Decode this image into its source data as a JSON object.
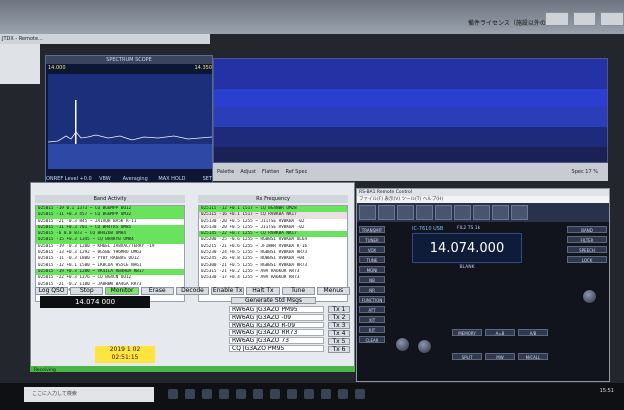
{
  "title_bar": {
    "left_window_title": "JTDX  - Remote...",
    "explorer_label": "備件ライセンス（施設以外の異物記）"
  },
  "spectrum": {
    "title": "SPECTRUM SCOPE",
    "left_freq": "14.000",
    "right_freq": "14.350",
    "buttons": [
      "ON",
      "REF Level +0.0 dB",
      "VBW NAR",
      "Averaging OFF",
      "MAX HOLD CLEAR",
      "SET"
    ]
  },
  "waterfall": {
    "controls": [
      "Palette",
      "Adjust",
      "Flatten",
      "Ref Spec"
    ],
    "zoom": "Spec 17 %"
  },
  "activity": {
    "band_activity_label": "Band Activity",
    "rx_frequency_label": "Rx Frequency",
    "left_rows": [
      {
        "text": "025015 -19  0.1 1373 ~ CQ BG6MPP OO12",
        "type": "cq"
      },
      {
        "text": "025015 -11 +0.3  457 ~ CQ BG6MPP OM32",
        "type": "cq"
      },
      {
        "text": "025015 -21 -0.3  845 ~ JA1VQH BA5K R-11",
        "type": "normal"
      },
      {
        "text": "025015 -11 +0.3  701 ~ CQ BH4TRS OM85",
        "type": "cq"
      },
      {
        "text": "025015  -6  0.0  873 ~ CQ BH4ZOB OM84",
        "type": "cq"
      },
      {
        "text": "025015 -15 +0.3 1345 ~ CQ BH4KYB OM84",
        "type": "cq"
      },
      {
        "text": "025015 -19 -0.3 1200 ~ KH6EL JA8VAC/TERRY -19",
        "type": "normal"
      },
      {
        "text": "025015 -13 +0.3 1292 ~ BG5BE YH6MRO OM63",
        "type": "normal"
      },
      {
        "text": "025015 -11 -0.3 1800 ~ YY0Y RA6BAS OO12",
        "type": "normal"
      },
      {
        "text": "025015 -12 +0.1 1500 ~ IK8CDA HS5CE NA61",
        "type": "normal"
      },
      {
        "text": "025015 -19 +0.3 1200 ~ VK4ILA RB4HUA RB17",
        "type": "cq"
      },
      {
        "text": "025015 -22 +0.3 1376 ~ CQ BG4CN OO12",
        "type": "normal"
      },
      {
        "text": "025015 -21 -0.2 1180 ~ JA8RWW BA4GA RR73",
        "type": "normal"
      },
      {
        "text": "025030 -16 +0.2 1240 ~ CQ BH8DSE OK82",
        "type": "normal"
      }
    ],
    "right_rows": [
      {
        "text": "025115 -12 +0.1 1517 ~ CQ BG4NBR OM28",
        "type": "cq"
      },
      {
        "text": "025115 -16 +0.1 1517 ~ CQ RV8KBA NK17",
        "type": "call"
      },
      {
        "text": "025130 -20 +0.5 1255 ~ JI1TSE RV8KBA -02",
        "type": "normal"
      },
      {
        "text": "025130 -20 +0.5 1255 ~ JI1TSE RV8KBA -02",
        "type": "normal"
      },
      {
        "text": "025145 -22 +0.7 1255 ~ CQ RV8KBA NK17",
        "type": "cq"
      },
      {
        "text": "025200 -25 -0.6 1255 ~ RG0BSI RV8KBA OL64",
        "type": "normal"
      },
      {
        "text": "025215 -21 +0.6 1255 ~ JF1WHR RV8KBA R-16",
        "type": "normal"
      },
      {
        "text": "025230 -24 +0.5 1255 ~ RG0BSI RV8KBA RR73",
        "type": "normal"
      },
      {
        "text": "025245 -26 +0.8 1255 ~ RU0BSI RV8KBA +04",
        "type": "normal"
      },
      {
        "text": "025300 -21 +0.5 1255 ~ RG0BSI RV8KBA RR73",
        "type": "normal"
      },
      {
        "text": "025315 -21 +0.2 1255 ~ A9A RA6KOR RR73",
        "type": "normal"
      },
      {
        "text": "025330 -17 +0.4 1255 ~ A9A RA6KOR RR73",
        "type": "normal"
      }
    ],
    "controls": [
      "Log QSO",
      "Stop",
      "Monitor",
      "Erase",
      "Decode",
      "Enable Tx",
      "Halt Tx",
      "Tune",
      "Menus"
    ],
    "frequency": "14.074 000",
    "band": "20m",
    "date": "2019 1 02",
    "time": "02:51:15",
    "generate_label": "Generate Std Msgs",
    "tx_messages": [
      "RW6AG JG3AZO PM95",
      "RW6AG JG3AZO -09",
      "RW6AG JG3AZO R-09",
      "RW6AG JG3AZO RR73",
      "RW6AG JG3AZO 73",
      "CQ JG3AZO PM95"
    ],
    "tx_buttons": [
      "Tx 1",
      "Tx 2",
      "Tx 3",
      "Tx 4",
      "Tx 5",
      "Tx 6"
    ],
    "status": "Receiving"
  },
  "rig": {
    "title": "RS-BA1 Remote Control",
    "menu": "ファイル(F)  表示(V)  ツール(T)  ヘルプ(H)",
    "model": "IC-7610",
    "mode_label": "USB",
    "filter": "FIL2  TS 1k",
    "frequency": "14.074.000",
    "blank_label": "BLANK",
    "side_buttons": [
      "TRANSMIT",
      "TUNER",
      "VOX",
      "TUNE",
      "MONI",
      "NB",
      "NR",
      "FUNCTION",
      "ATT",
      "XIT",
      "RIT",
      "CLEAR"
    ],
    "right_labels": [
      "BAND",
      "FILTER",
      "SPEECH",
      "LOCK"
    ],
    "lower_labels": [
      "MEMORY",
      "A=B",
      "A/B",
      "SPLIT",
      "MW",
      "M/CALL"
    ]
  },
  "taskbar": {
    "search_placeholder": "ここに入力して検索",
    "clock": "15:51"
  }
}
